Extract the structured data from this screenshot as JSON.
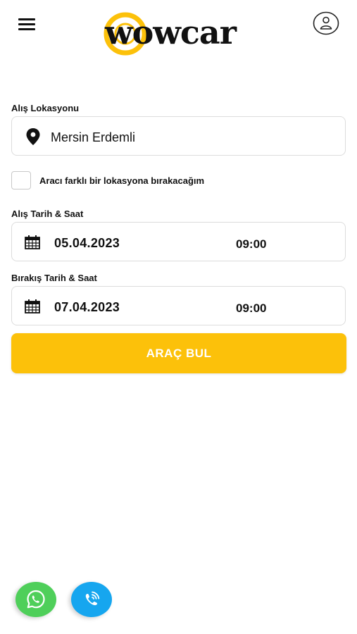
{
  "header": {
    "menu_icon": "hamburger-menu-icon",
    "logo_text": "wowcar",
    "logo_accent_color": "#fcc10a",
    "account_icon": "user-account-icon"
  },
  "pickup_location": {
    "label": "Alış Lokasyonu",
    "icon": "location-pin-icon",
    "value": "Mersin Erdemli"
  },
  "different_dropoff": {
    "label": "Aracı farklı bir lokasyona bırakacağım",
    "checked": false
  },
  "pickup_datetime": {
    "label": "Alış Tarih & Saat",
    "icon": "calendar-icon",
    "date": "05.04.2023",
    "time": "09:00"
  },
  "dropoff_datetime": {
    "label": "Bırakış Tarih & Saat",
    "icon": "calendar-icon",
    "date": "07.04.2023",
    "time": "09:00"
  },
  "search_button": {
    "label": "ARAÇ BUL",
    "color": "#fcc10a"
  },
  "floating_actions": {
    "whatsapp_icon": "whatsapp-icon",
    "whatsapp_color": "#4fcf5a",
    "phone_icon": "phone-call-icon",
    "phone_color": "#16a6ef"
  }
}
